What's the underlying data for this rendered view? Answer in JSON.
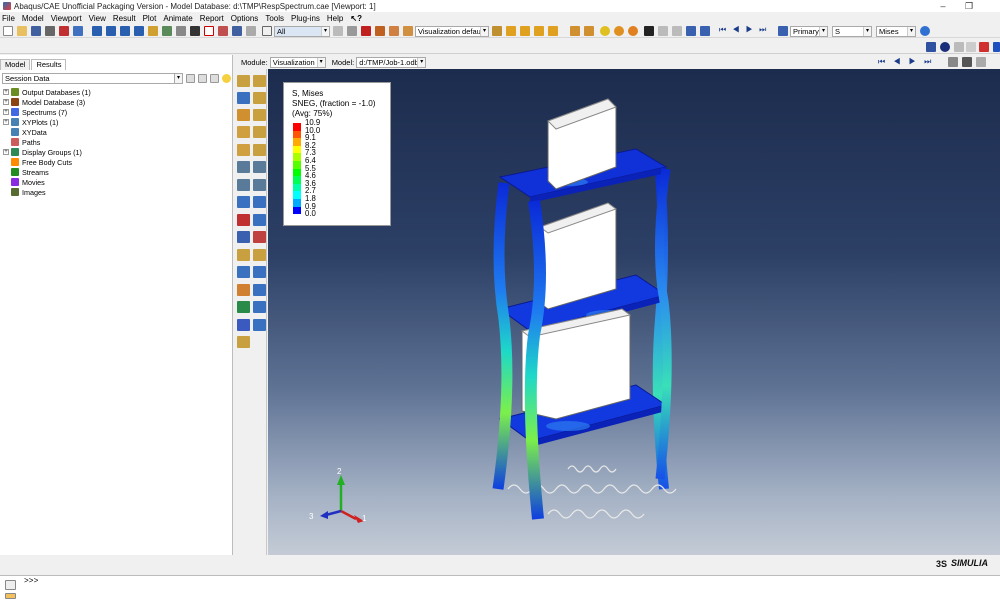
{
  "window": {
    "title": "Abaqus/CAE Unofficial Packaging Version - Model Database: d:\\TMP\\RespSpectrum.cae [Viewport: 1]",
    "minimize": "–",
    "maximize": "❐"
  },
  "menu": [
    "File",
    "Model",
    "Viewport",
    "View",
    "Result",
    "Plot",
    "Animate",
    "Report",
    "Options",
    "Tools",
    "Plug-ins",
    "Help"
  ],
  "toolbar": {
    "selection_filter": "All",
    "view_defaults": "Visualization defaults",
    "output_position": "Primary",
    "variable": "S",
    "invariant": "Mises"
  },
  "module_bar": {
    "module_label": "Module:",
    "module_value": "Visualization",
    "model_label": "Model:",
    "model_value": "d:/TMP/Job-1.odb"
  },
  "tabs": [
    "Model",
    "Results"
  ],
  "session_header": "Session Data",
  "tree": [
    {
      "label": "Output Databases (1)",
      "expandable": true,
      "icon_color": "#6b8e23"
    },
    {
      "label": "Model Database (3)",
      "expandable": true,
      "icon_color": "#8b4513"
    },
    {
      "label": "Spectrums (7)",
      "expandable": true,
      "icon_color": "#4169e1"
    },
    {
      "label": "XYPlots (1)",
      "expandable": true,
      "icon_color": "#4682b4"
    },
    {
      "label": "XYData",
      "expandable": false,
      "icon_color": "#4682b4"
    },
    {
      "label": "Paths",
      "expandable": false,
      "icon_color": "#cd5c5c"
    },
    {
      "label": "Display Groups (1)",
      "expandable": true,
      "icon_color": "#2e8b57"
    },
    {
      "label": "Free Body Cuts",
      "expandable": false,
      "icon_color": "#ff8c00"
    },
    {
      "label": "Streams",
      "expandable": false,
      "icon_color": "#228b22"
    },
    {
      "label": "Movies",
      "expandable": false,
      "icon_color": "#8a2be2"
    },
    {
      "label": "Images",
      "expandable": false,
      "icon_color": "#556b2f"
    }
  ],
  "legend": {
    "line1": "S, Mises",
    "line2": "SNEG, (fraction = -1.0)",
    "line3": "(Avg: 75%)",
    "values": [
      "10.9",
      "10.0",
      "9.1",
      "8.2",
      "7.3",
      "6.4",
      "5.5",
      "4.6",
      "3.6",
      "2.7",
      "1.8",
      "0.9",
      "0.0"
    ],
    "colors": [
      "#ff0000",
      "#ff5500",
      "#ffaa00",
      "#ffff00",
      "#aaff00",
      "#55ff00",
      "#00ff00",
      "#00ff55",
      "#00ffaa",
      "#00ffff",
      "#00aaff",
      "#0055ff",
      "#0000ff"
    ]
  },
  "triad": {
    "x": "1",
    "y": "2",
    "z": "3"
  },
  "brand": "SIMULIA",
  "console": {
    "prompt": ">>>"
  }
}
